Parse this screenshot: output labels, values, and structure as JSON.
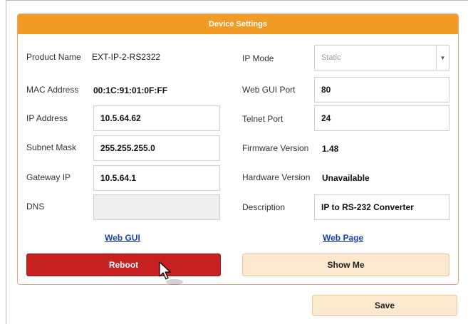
{
  "panel": {
    "title": "Device Settings"
  },
  "left": {
    "product_name": {
      "label": "Product Name",
      "value": "EXT-IP-2-RS2322"
    },
    "mac_address": {
      "label": "MAC Address",
      "value": "00:1C:91:01:0F:FF"
    },
    "ip_address": {
      "label": "IP Address",
      "value": "10.5.64.62"
    },
    "subnet_mask": {
      "label": "Subnet Mask",
      "value": "255.255.255.0"
    },
    "gateway_ip": {
      "label": "Gateway IP",
      "value": "10.5.64.1"
    },
    "dns": {
      "label": "DNS",
      "value": ""
    },
    "link": "Web GUI",
    "button": "Reboot"
  },
  "right": {
    "ip_mode": {
      "label": "IP Mode",
      "value": "Static"
    },
    "web_gui_port": {
      "label": "Web GUI Port",
      "value": "80"
    },
    "telnet_port": {
      "label": "Telnet Port",
      "value": "24"
    },
    "firmware_version": {
      "label": "Firmware Version",
      "value": "1.48"
    },
    "hardware_version": {
      "label": "Hardware Version",
      "value": "Unavailable"
    },
    "description": {
      "label": "Description",
      "value": "IP to RS-232 Converter"
    },
    "link": "Web Page",
    "button": "Show Me"
  },
  "footer": {
    "save": "Save"
  },
  "colors": {
    "header": "#f29b24",
    "reboot": "#c62020",
    "beige_button": "#fbe9cf",
    "link": "#1a3fa8"
  }
}
